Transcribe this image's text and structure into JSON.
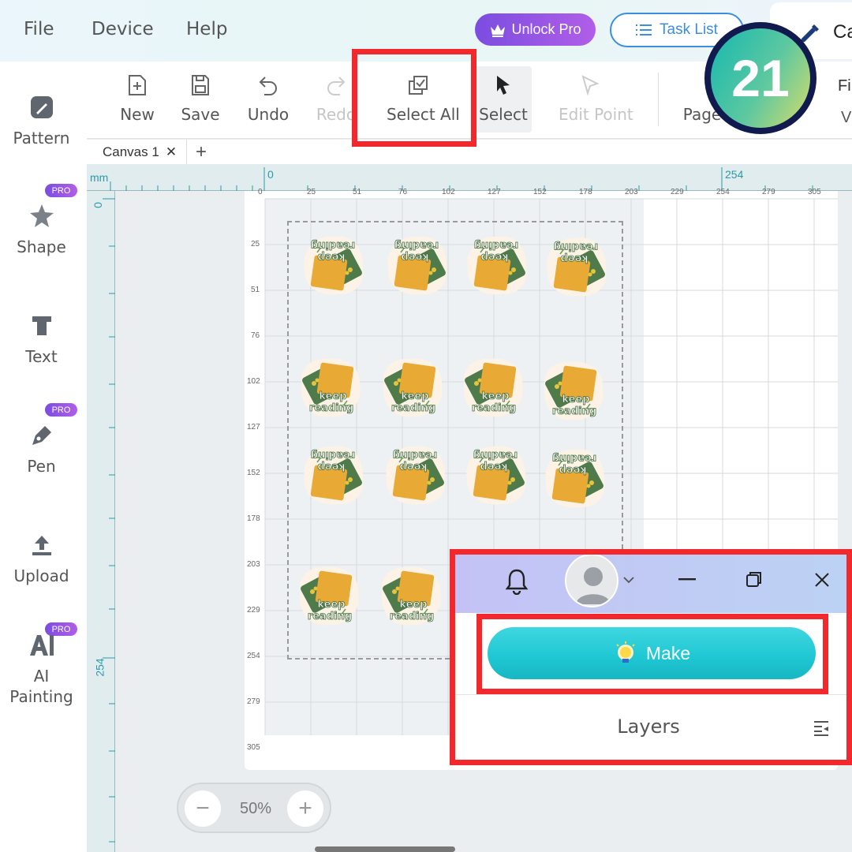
{
  "menu": {
    "file": "File",
    "device": "Device",
    "help": "Help"
  },
  "header": {
    "unlock_pro": "Unlock Pro",
    "task_list": "Task List",
    "right_tab": "Ca"
  },
  "step_badge": "21",
  "sidebar": {
    "pro": "PRO",
    "items": [
      {
        "label": "Pattern",
        "icon": "pattern-icon"
      },
      {
        "label": "Shape",
        "icon": "star-shape-icon",
        "pro": true
      },
      {
        "label": "Text",
        "icon": "text-icon"
      },
      {
        "label": "Pen",
        "icon": "pen-icon",
        "pro": true
      },
      {
        "label": "Upload",
        "icon": "upload-icon"
      },
      {
        "label": "AI\nPainting",
        "line1": "AI",
        "line2": "Painting",
        "icon": "ai-painting-icon",
        "pro": true
      }
    ]
  },
  "toolbar": {
    "new": "New",
    "save": "Save",
    "undo": "Undo",
    "redo": "Redo",
    "select_all": "Select All",
    "select": "Select",
    "edit_point": "Edit Point",
    "page": "Page",
    "fi": "Fi",
    "v": "V"
  },
  "tabs": {
    "canvas1": "Canvas 1",
    "close": "✕",
    "add": "+"
  },
  "ruler": {
    "unit": "mm",
    "top_major": [
      "0",
      "254"
    ],
    "top_minor": [
      "0",
      "25",
      "51",
      "76",
      "102",
      "127",
      "152",
      "178",
      "203",
      "229",
      "254",
      "279",
      "305"
    ],
    "left_major": [
      "0",
      "254"
    ],
    "left_minor": [
      "25",
      "51",
      "76",
      "102",
      "127",
      "152",
      "178",
      "203",
      "229",
      "254",
      "279",
      "305"
    ]
  },
  "stickers": {
    "text1": "keep",
    "text2": "reading"
  },
  "zoom": {
    "value": "50%",
    "minus": "−",
    "plus": "+"
  },
  "panel": {
    "make": "Make",
    "layers": "Layers"
  },
  "colors": {
    "accent": "#1ec7d3",
    "highlight": "#f3282c",
    "pro": "#9b55e6",
    "ruler_text": "#2a9aa8"
  }
}
